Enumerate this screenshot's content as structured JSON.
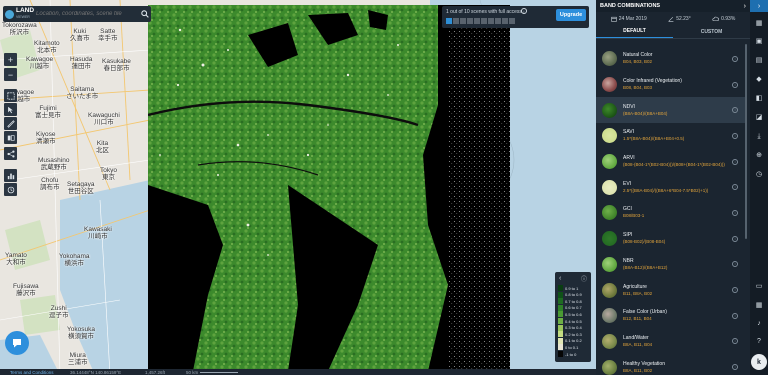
{
  "search": {
    "placeholder": "Location, coordinates, scene tile",
    "logo_line1": "LAND",
    "logo_line2": "VIEWER"
  },
  "map": {
    "cities": [
      {
        "en": "Tokorozawa",
        "jp": "所沢市"
      },
      {
        "en": "Kitamoto",
        "jp": "北本市"
      },
      {
        "en": "Kuki",
        "jp": "久喜市"
      },
      {
        "en": "Satte",
        "jp": "幸手市"
      },
      {
        "en": "Kawagoe",
        "jp": "川越市"
      },
      {
        "en": "Hasuda",
        "jp": "蓮田市"
      },
      {
        "en": "Kasukabe",
        "jp": "春日部市"
      },
      {
        "en": "Saitama",
        "jp": "さいたま市"
      },
      {
        "en": "Kawagoe",
        "jp": "川越市"
      },
      {
        "en": "Fujimi",
        "jp": "富士見市"
      },
      {
        "en": "Kawaguchi",
        "jp": "川口市"
      },
      {
        "en": "Kiyose",
        "jp": "清瀬市"
      },
      {
        "en": "Kita",
        "jp": "北区"
      },
      {
        "en": "Musashino",
        "jp": "武蔵野市"
      },
      {
        "en": "Tokyo",
        "jp": "東京"
      },
      {
        "en": "Chofu",
        "jp": "調布市"
      },
      {
        "en": "Setagaya",
        "jp": "世田谷区"
      },
      {
        "en": "Kawasaki",
        "jp": "川崎市"
      },
      {
        "en": "Yamato",
        "jp": "大和市"
      },
      {
        "en": "Yokohama",
        "jp": "横浜市"
      },
      {
        "en": "Fujisawa",
        "jp": "藤沢市"
      },
      {
        "en": "Zushi",
        "jp": "逗子市"
      },
      {
        "en": "Yokosuka",
        "jp": "横須賀市"
      },
      {
        "en": "Miura",
        "jp": "三浦市"
      }
    ]
  },
  "notice": {
    "text": "1 out of 10 scenes with full access",
    "upgrade_label": "Upgrade",
    "total_dots": 10,
    "active_dots": 1
  },
  "legend": {
    "rows": [
      {
        "label": "0.9 to 1",
        "color": "#0a3d12"
      },
      {
        "label": "0.8 to 0.9",
        "color": "#0f5218"
      },
      {
        "label": "0.7 to 0.8",
        "color": "#1f6b22"
      },
      {
        "label": "0.6 to 0.7",
        "color": "#2f8128"
      },
      {
        "label": "0.5 to 0.6",
        "color": "#4a9a33"
      },
      {
        "label": "0.4 to 0.5",
        "color": "#6daf45"
      },
      {
        "label": "0.3 to 0.4",
        "color": "#9ac65d"
      },
      {
        "label": "0.2 to 0.3",
        "color": "#c4dc82"
      },
      {
        "label": "0.1 to 0.2",
        "color": "#e2e6b4"
      },
      {
        "label": "0 to 0.1",
        "color": "#e8e4d2"
      },
      {
        "label": "-1 to 0",
        "color": "#050505"
      }
    ]
  },
  "bottombar": {
    "terms": "Terms and Conditions",
    "coords": "36.14448°N 140.86159°E",
    "elev": "1,457.26ft",
    "scale": "50 km"
  },
  "panel": {
    "title": "BAND COMBINATIONS",
    "date": "24 Mar 2019",
    "sun_angle": "52.23°",
    "cloud": "0.93%",
    "tabs": [
      {
        "label": "DEFAULT",
        "active": true
      },
      {
        "label": "CUSTOM",
        "active": false
      }
    ],
    "items": [
      {
        "name": "Natural Color",
        "formula": "B04, B03, B02",
        "thumb": "radial-gradient(circle at 40% 40%, #9aa183, #5f6d52 60%, #3e4a35)"
      },
      {
        "name": "Color Infrared (Vegetation)",
        "formula": "B08, B04, B03",
        "thumb": "radial-gradient(circle at 40% 40%, #c9a6a0, #8a4a4a 60%, #5a2e2e)"
      },
      {
        "name": "NDVI",
        "formula": "(B8A-B04)/(B8A+B04)",
        "thumb": "radial-gradient(circle at 40% 40%, #3e8a2a, #1f5a18 60%, #0e3a0c)",
        "selected": true
      },
      {
        "name": "SAVI",
        "formula": "1.5*(B8A-B04)/(B8A+B04+0.5)",
        "thumb": "radial-gradient(circle, #d9e6a2, #c7d985)"
      },
      {
        "name": "ARVI",
        "formula": "(B08-(B04-1*(B02-B04)))/(B08+(B04-1*(B02-B04)))",
        "thumb": "radial-gradient(circle at 40% 40%, #9fd27a, #5ea63d 70%)"
      },
      {
        "name": "EVI",
        "formula": "2.5*((B8A-B04)/((B8A+6*B04-7.5*B02)+1))",
        "thumb": "radial-gradient(circle, #e9edc4, #d8dfa6)"
      },
      {
        "name": "GCI",
        "formula": "B08/B03-1",
        "thumb": "radial-gradient(circle at 40% 40%, #6fb04a, #3d8128 70%)"
      },
      {
        "name": "SIPI",
        "formula": "(B08-B02)/(B08-B04)",
        "thumb": "radial-gradient(circle, #2f7a2a, #1f6420)"
      },
      {
        "name": "NBR",
        "formula": "(B8A-B12)/(B8A+B12)",
        "thumb": "radial-gradient(circle at 40% 40%, #9fd27a, #5aa33a 70%)"
      },
      {
        "name": "Agriculture",
        "formula": "B11, B8A, B02",
        "thumb": "radial-gradient(circle at 40% 40%, #b0a86a, #6f7a3c 60%, #4a5a2a)"
      },
      {
        "name": "False Color (Urban)",
        "formula": "B12, B11, B04",
        "thumb": "radial-gradient(circle at 40% 40%, #b7a9a0, #6e7a6a 60%, #4a5247)"
      },
      {
        "name": "Land/Water",
        "formula": "B8A, B11, B04",
        "thumb": "radial-gradient(circle at 40% 40%, #b5b070, #7a8a4a 60%, #4b5a30)"
      },
      {
        "name": "Healthy Vegetation",
        "formula": "B8A, B11, B02",
        "thumb": "radial-gradient(circle at 40% 40%, #a5b16c, #6a7f40 60%, #47582a)"
      }
    ]
  },
  "user": {
    "initial": "k"
  }
}
